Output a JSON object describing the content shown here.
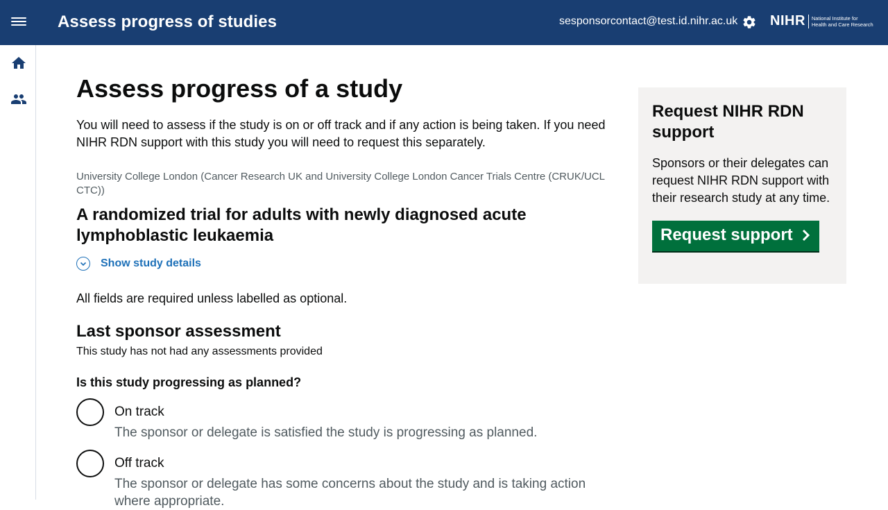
{
  "header": {
    "title": "Assess progress of studies",
    "user_email": "sesponsorcontact@test.id.nihr.ac.uk",
    "logo_text": "NIHR",
    "logo_tagline_1": "National Institute for",
    "logo_tagline_2": "Health and Care Research",
    "icons": [
      "menu-icon",
      "gear-icon"
    ]
  },
  "sidebar": {
    "items": [
      {
        "icon": "home-icon"
      },
      {
        "icon": "people-icon"
      }
    ]
  },
  "main": {
    "heading": "Assess progress of a study",
    "intro": "You will need to assess if the study is on or off track and if any action is being taken. If you need NIHR RDN support with this study you will need to request this separately.",
    "organisation": "University College London (Cancer Research UK and University College London Cancer Trials Centre (CRUK/UCL CTC))",
    "study_title": "A randomized trial for adults with newly diagnosed acute lymphoblastic leukaemia",
    "show_details_label": "Show study details",
    "required_note": "All fields are required unless labelled as optional.",
    "last_assessment_heading": "Last sponsor assessment",
    "last_assessment_text": "This study has not had any assessments provided",
    "question": "Is this study progressing as planned?",
    "options": [
      {
        "label": "On track",
        "hint": "The sponsor or delegate is satisfied the study is progressing as planned."
      },
      {
        "label": "Off track",
        "hint": "The sponsor or delegate has some concerns about the study and is taking action where appropriate."
      }
    ]
  },
  "aside": {
    "heading": "Request NIHR RDN support",
    "text": "Sponsors or their delegates can request NIHR RDN support with their research study at any time.",
    "button_label": "Request support"
  },
  "colors": {
    "header_bg": "#193e72",
    "link": "#1d70b8",
    "button_green": "#00703c",
    "panel_bg": "#f3f2f1"
  }
}
